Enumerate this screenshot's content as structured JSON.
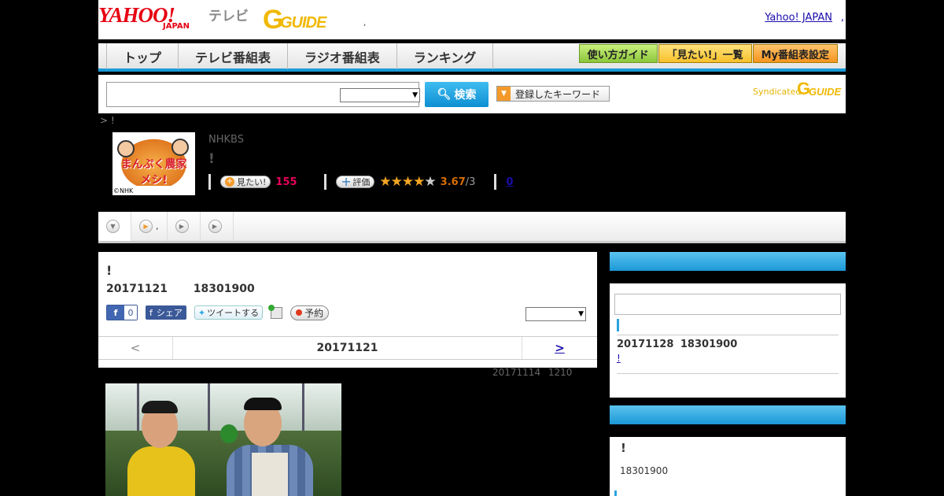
{
  "header": {
    "yahoo_logo": "YAHOO!",
    "japan_logo": "JAPAN",
    "tv_label": "テレビ",
    "gguide_g": "G",
    "gguide_text": "GUIDE",
    "dot": ",",
    "yahoo_japan_link": "Yahoo! JAPAN",
    "trailing_dot": ","
  },
  "nav": {
    "tabs": [
      "トップ",
      "テレビ番組表",
      "ラジオ番組表",
      "ランキング"
    ],
    "buttons": [
      "使い方ガイド",
      "「見たい!」一覧",
      "My番組表設定"
    ]
  },
  "search": {
    "input_value": "",
    "select_value": "",
    "button_label": "検索",
    "keyword_button": "登録したキーワード",
    "syndicated_label": "Syndicated",
    "syndicated_logo_g": "G",
    "syndicated_logo_text": "GUIDE"
  },
  "breadcrumb": "> !",
  "program": {
    "thumb_title": "まんぷく農家メシ!",
    "thumb_credit": "©NHK",
    "channel": "NHKBS",
    "title": "!",
    "mitai_label": "見たい!",
    "mitai_count": "155",
    "rate_label": "評価",
    "rating": "3.67",
    "rating_of": "/3",
    "reviews": "0",
    "stars_filled": 3.5
  },
  "subtabs": [
    {
      "label": ""
    },
    {
      "label": ","
    },
    {
      "label": ""
    },
    {
      "label": ""
    }
  ],
  "episode": {
    "title": "!",
    "date": "20171121 18301900",
    "fb_like_count": "0",
    "fb_share": "シェア",
    "tweet": "ツイートする",
    "record": "予約",
    "select_value": "",
    "prev": "<",
    "pager_date": "20171121",
    "next": ">",
    "updated": "20171114 1210"
  },
  "side1": {
    "input_value": "",
    "next_date": "20171128 18301900",
    "next_link": "!"
  },
  "side2": {
    "title": "!",
    "time": "18301900"
  },
  "colors": {
    "accent_blue": "#1a9ad6",
    "yahoo_red": "#e60012",
    "gguide_yellow": "#f0b800",
    "mitai_pink": "#e6005a",
    "rating_orange": "#d96d00"
  }
}
